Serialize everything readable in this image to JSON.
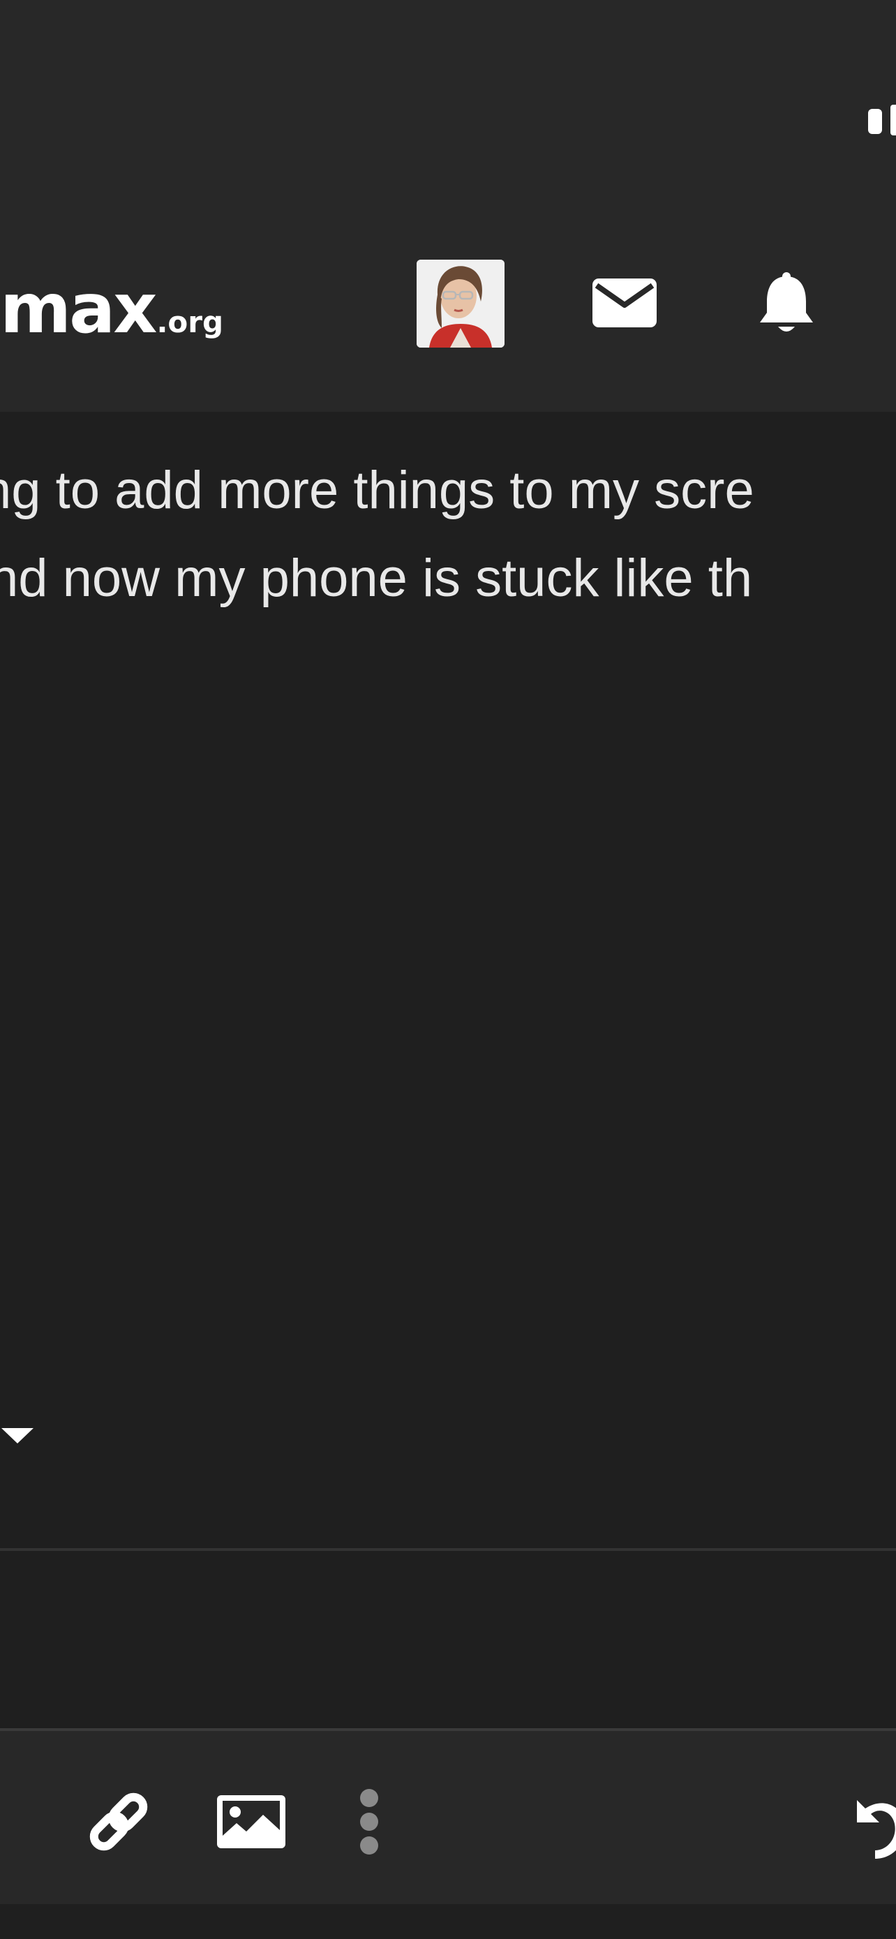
{
  "header": {
    "logo_main": "max",
    "logo_tld": ".org",
    "avatar_icon": "user-avatar-photo",
    "mail_icon": "envelope-icon",
    "bell_icon": "bell-icon"
  },
  "post": {
    "lines": [
      "ng to add more things to my scre",
      "nd now my phone is stuck like th"
    ],
    "expand_icon": "caret-down-icon"
  },
  "editor_toolbar": {
    "link_icon": "link-icon",
    "image_icon": "image-icon",
    "more_icon": "vertical-ellipsis-icon",
    "undo_icon": "undo-icon"
  },
  "colors": {
    "background": "#1f1f1f",
    "header_bg": "#282828",
    "text": "#e8e8e8",
    "icon": "#ffffff",
    "muted_icon": "#8a8a8a"
  }
}
